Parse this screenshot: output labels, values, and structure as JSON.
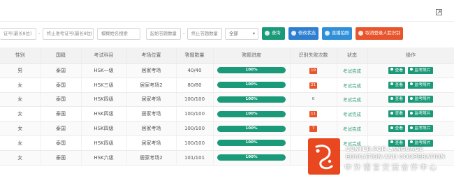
{
  "toolbar": {
    "expand_icon": "expand-icon"
  },
  "filters": {
    "start_cert_placeholder": "证号(最长8位)",
    "range_sep_1": "-",
    "end_cert_placeholder": "终止准考证号(最长8位)",
    "name_placeholder": "模糊姓名搜索",
    "start_count_placeholder": "起始答题数量",
    "range_sep_2": "-",
    "end_count_placeholder": "终止答题数量",
    "select_value": "全部",
    "buttons": {
      "search": "查询",
      "modify_status": "修改状态",
      "capture": "直播拍照",
      "cancel_login": "取消登录人脸识别"
    },
    "colors": {
      "search": "#1a9a78",
      "modify_status": "#2f7fd1",
      "capture": "#2f8fd8",
      "cancel_login": "#e8552d"
    }
  },
  "table": {
    "headers": [
      "性别",
      "国籍",
      "考试科目",
      "考场位置",
      "答题数量",
      "答题进度",
      "识别失败次数",
      "状态",
      "操作"
    ],
    "rows": [
      {
        "gender": "男",
        "nationality": "泰国",
        "subject": "HSK一级",
        "location": "居家考场",
        "answered": "40/40",
        "progress": "100%",
        "failures": "19",
        "status": "考试完成",
        "view": "查看",
        "photo": "监考照片"
      },
      {
        "gender": "女",
        "nationality": "泰国",
        "subject": "HSK三级",
        "location": "居家考场2",
        "answered": "80/80",
        "progress": "100%",
        "failures": "21",
        "status": "考试完成",
        "view": "查看",
        "photo": "监考照片"
      },
      {
        "gender": "女",
        "nationality": "泰国",
        "subject": "HSK四级",
        "location": "居家考场",
        "answered": "100/100",
        "progress": "100%",
        "failures": "0",
        "status": "考试完成",
        "view": "查看",
        "photo": "监考照片"
      },
      {
        "gender": "女",
        "nationality": "泰国",
        "subject": "HSK四级",
        "location": "居家考场",
        "answered": "100/100",
        "progress": "100%",
        "failures": "11",
        "status": "考试完成",
        "view": "查看",
        "photo": "监考照片"
      },
      {
        "gender": "女",
        "nationality": "泰国",
        "subject": "HSK四级",
        "location": "居家考场",
        "answered": "100/100",
        "progress": "100%",
        "failures": "7",
        "status": "考试完成",
        "view": "查看",
        "photo": "监考照片"
      },
      {
        "gender": "女",
        "nationality": "泰国",
        "subject": "HSK四级",
        "location": "居家考场",
        "answered": "100/100",
        "progress": "100%",
        "failures": "8",
        "status": "考试完成",
        "view": "查看",
        "photo": "监考照片"
      },
      {
        "gender": "女",
        "nationality": "泰国",
        "subject": "HSK六级",
        "location": "居家考场2",
        "answered": "101/101",
        "progress": "100%",
        "failures": "",
        "status": "",
        "view": "",
        "photo": ""
      }
    ],
    "colors": {
      "progress": "#1a9a78",
      "failures_badge": "#e8552d",
      "status_text": "#3aa07e"
    }
  },
  "watermark": {
    "line1": "CENTER FOR LANGUAGE",
    "line2": "EDUCATION AND COOPERATION",
    "line3": "中外语言交流合作中心"
  }
}
